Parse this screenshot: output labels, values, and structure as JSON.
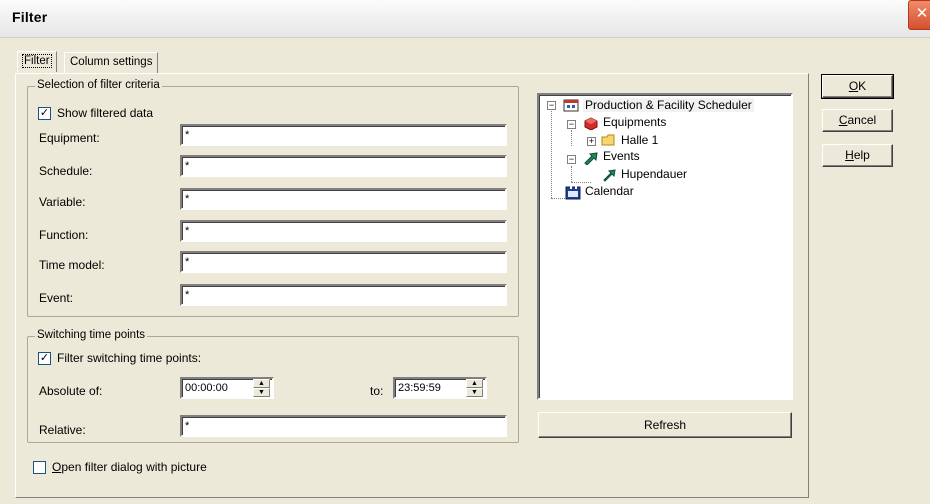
{
  "window": {
    "title": "Filter",
    "close_glyph": "✕"
  },
  "tabs": [
    {
      "label": "Filter",
      "active": true
    },
    {
      "label": "Column settings",
      "active": false
    }
  ],
  "criteria": {
    "legend": "Selection of filter criteria",
    "show_filtered": {
      "label": "Show filtered data",
      "checked": true
    },
    "rows": [
      {
        "label": "Equipment:",
        "value": "*"
      },
      {
        "label": "Schedule:",
        "value": "*"
      },
      {
        "label": "Variable:",
        "value": "*"
      },
      {
        "label": "Function:",
        "value": "*"
      },
      {
        "label": "Time model:",
        "value": "*"
      },
      {
        "label": "Event:",
        "value": "*"
      }
    ]
  },
  "switching": {
    "legend": "Switching time points",
    "filter_check": {
      "label": "Filter switching time points:",
      "checked": true
    },
    "absolute_label": "Absolute of:",
    "absolute_value": "00:00:00",
    "to_label": "to:",
    "to_value": "23:59:59",
    "relative_label": "Relative:",
    "relative_value": "*"
  },
  "open_with_picture": {
    "label_accel": "O",
    "label_rest": "pen filter dialog with picture",
    "checked": false
  },
  "tree": {
    "nodes": [
      {
        "label": "Production & Facility Scheduler",
        "icon": "scheduler-icon"
      },
      {
        "label": "Equipments",
        "icon": "equipment-icon"
      },
      {
        "label": "Halle 1",
        "icon": "folder-icon"
      },
      {
        "label": "Events",
        "icon": "events-icon"
      },
      {
        "label": "Hupendauer",
        "icon": "event-arrow-icon"
      },
      {
        "label": "Calendar",
        "icon": "calendar-icon"
      }
    ]
  },
  "buttons": {
    "refresh": "Refresh",
    "ok_accel": "O",
    "ok_rest": "K",
    "cancel_accel": "C",
    "cancel_rest": "ancel",
    "help_accel": "H",
    "help_rest": "elp"
  },
  "colors": {
    "background": "#ece9d8",
    "close": "#d4502e"
  }
}
